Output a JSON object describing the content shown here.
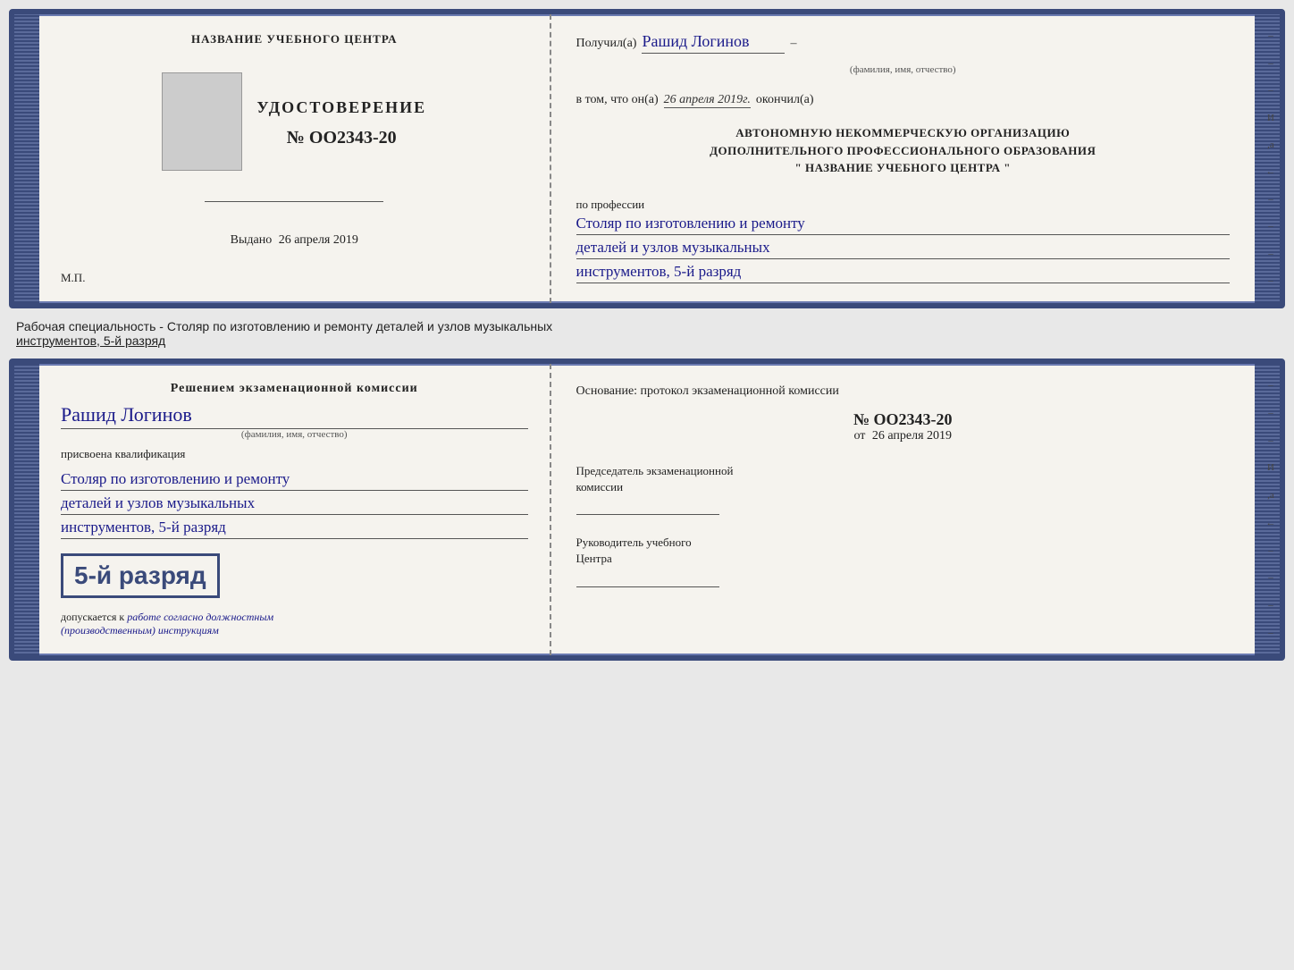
{
  "top_card": {
    "left": {
      "title": "НАЗВАНИЕ УЧЕБНОГО ЦЕНТРА",
      "cert_label": "УДОСТОВЕРЕНИЕ",
      "cert_number": "№ OO2343-20",
      "issued_label": "Выдано",
      "issued_date": "26 апреля 2019",
      "mp": "М.П."
    },
    "right": {
      "received_label": "Получил(а)",
      "received_name": "Рашид Логинов",
      "name_subtext": "(фамилия, имя, отчество)",
      "date_prefix": "в том, что он(а)",
      "date_value": "26 апреля 2019г.",
      "date_suffix": "окончил(а)",
      "org_text_line1": "АВТОНОМНУЮ НЕКОММЕРЧЕСКУЮ ОРГАНИЗАЦИЮ",
      "org_text_line2": "ДОПОЛНИТЕЛЬНОГО ПРОФЕССИОНАЛЬНОГО ОБРАЗОВАНИЯ",
      "org_text_line3": "\"  НАЗВАНИЕ УЧЕБНОГО ЦЕНТРА  \"",
      "profession_label": "по профессии",
      "profession_line1": "Столяр по изготовлению и ремонту",
      "profession_line2": "деталей и узлов музыкальных",
      "profession_line3": "инструментов, 5-й разряд"
    }
  },
  "specialty_text": "Рабочая специальность - Столяр по изготовлению и ремонту деталей и узлов музыкальных",
  "specialty_text2": "инструментов, 5-й разряд",
  "bottom_card": {
    "left": {
      "commission_label": "Решением экзаменационной комиссии",
      "name": "Рашид Логинов",
      "name_subtext": "(фамилия, имя, отчество)",
      "assigned_label": "присвоена квалификация",
      "profession_line1": "Столяр по изготовлению и ремонту",
      "profession_line2": "деталей и узлов музыкальных",
      "profession_line3": "инструментов, 5-й разряд",
      "rank_text": "5-й разряд",
      "allowed_prefix": "допускается к",
      "allowed_value": "работе согласно должностным",
      "allowed_value2": "(производственным) инструкциям"
    },
    "right": {
      "basis_label": "Основание: протокол экзаменационной комиссии",
      "protocol_number": "№  OO2343-20",
      "date_prefix": "от",
      "date_value": "26 апреля 2019",
      "chairman_label": "Председатель экзаменационной",
      "chairman_label2": "комиссии",
      "director_label": "Руководитель учебного",
      "director_label2": "Центра"
    }
  },
  "vert_marks_top": [
    "-",
    "-",
    "-",
    "И",
    ",а",
    "←",
    "-",
    "-",
    "-",
    "-"
  ],
  "vert_marks_bottom": [
    "-",
    "-",
    "-",
    "И",
    ",а",
    "←",
    "-",
    "-",
    "-",
    "-"
  ]
}
